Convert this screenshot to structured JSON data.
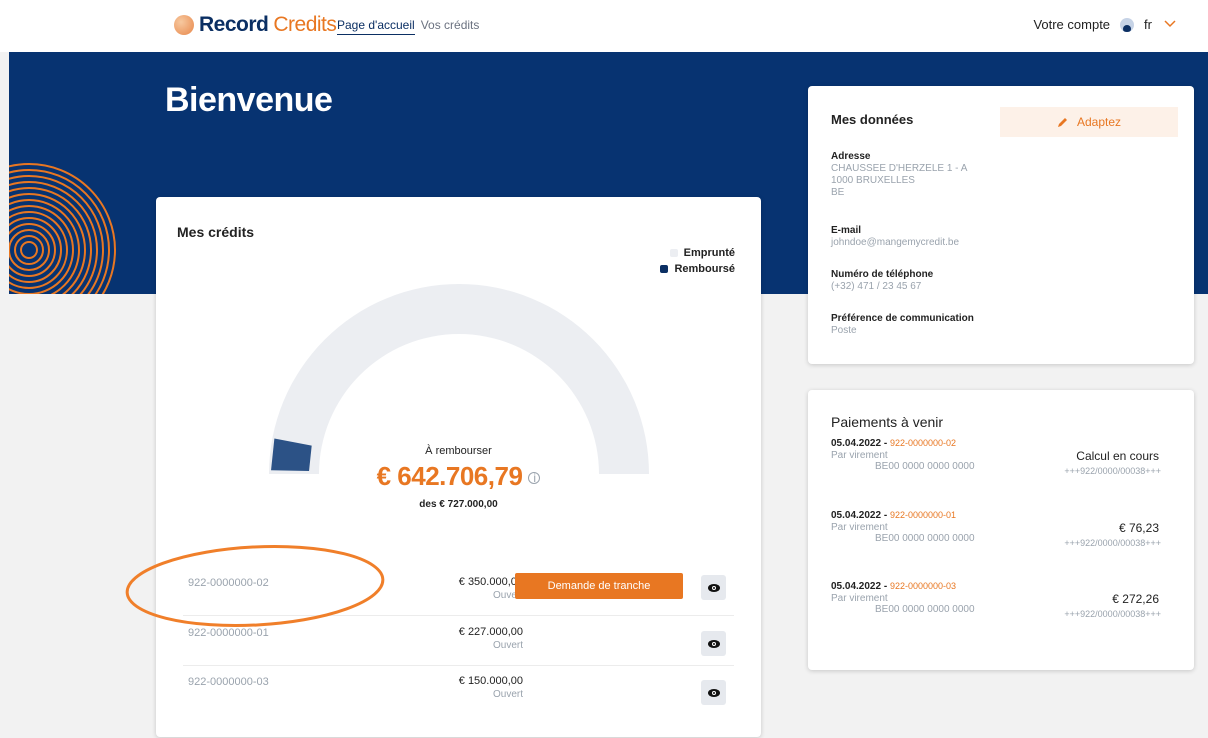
{
  "brand": {
    "name_a": "Record",
    "name_b": "Credits"
  },
  "nav": {
    "home": "Page d'accueil",
    "credits": "Vos crédits"
  },
  "account": {
    "label": "Votre compte",
    "lang": "fr"
  },
  "hero": {
    "title": "Bienvenue"
  },
  "credits": {
    "title": "Mes crédits",
    "legend": {
      "borrowed": "Emprunté",
      "repaid": "Remboursé"
    },
    "to_repay_label": "À rembourser",
    "to_repay_amount": "€ 642.706,79",
    "of_total": "des € 727.000,00",
    "repaid_fraction": 0.116,
    "rows": [
      {
        "number": "922-0000000-02",
        "amount": "€ 350.000,00",
        "status": "Ouvert",
        "action": "Demande de tranche"
      },
      {
        "number": "922-0000000-01",
        "amount": "€ 227.000,00",
        "status": "Ouvert"
      },
      {
        "number": "922-0000000-03",
        "amount": "€ 150.000,00",
        "status": "Ouvert"
      }
    ]
  },
  "data": {
    "title": "Mes données",
    "edit_label": "Adaptez",
    "address_label": "Adresse",
    "address_l1": "CHAUSSEE D'HERZELE 1 - A",
    "address_l2": "1000 BRUXELLES",
    "address_l3": "BE",
    "email_label": "E-mail",
    "email": "johndoe@mangemycredit.be",
    "phone_label": "Numéro de téléphone",
    "phone": "(+32) 471 / 23 45 67",
    "pref_label": "Préférence de communication",
    "pref": "Poste"
  },
  "payments": {
    "title": "Paiements à venir",
    "items": [
      {
        "date": "05.04.2022",
        "ref": "922-0000000-02",
        "method": "Par virement",
        "iban": "BE00 0000 0000 0000",
        "amount": "Calcul en cours",
        "comm": "+++922/0000/00038+++"
      },
      {
        "date": "05.04.2022",
        "ref": "922-0000000-01",
        "method": "Par virement",
        "iban": "BE00 0000 0000 0000",
        "amount": "€ 76,23",
        "comm": "+++922/0000/00038+++"
      },
      {
        "date": "05.04.2022",
        "ref": "922-0000000-03",
        "method": "Par virement",
        "iban": "BE00 0000 0000 0000",
        "amount": "€ 272,26",
        "comm": "+++922/0000/00038+++"
      }
    ]
  },
  "colors": {
    "navy": "#073371",
    "orange": "#e87722",
    "gauge_track": "#eceef2",
    "gauge_fill": "#2c5286"
  }
}
